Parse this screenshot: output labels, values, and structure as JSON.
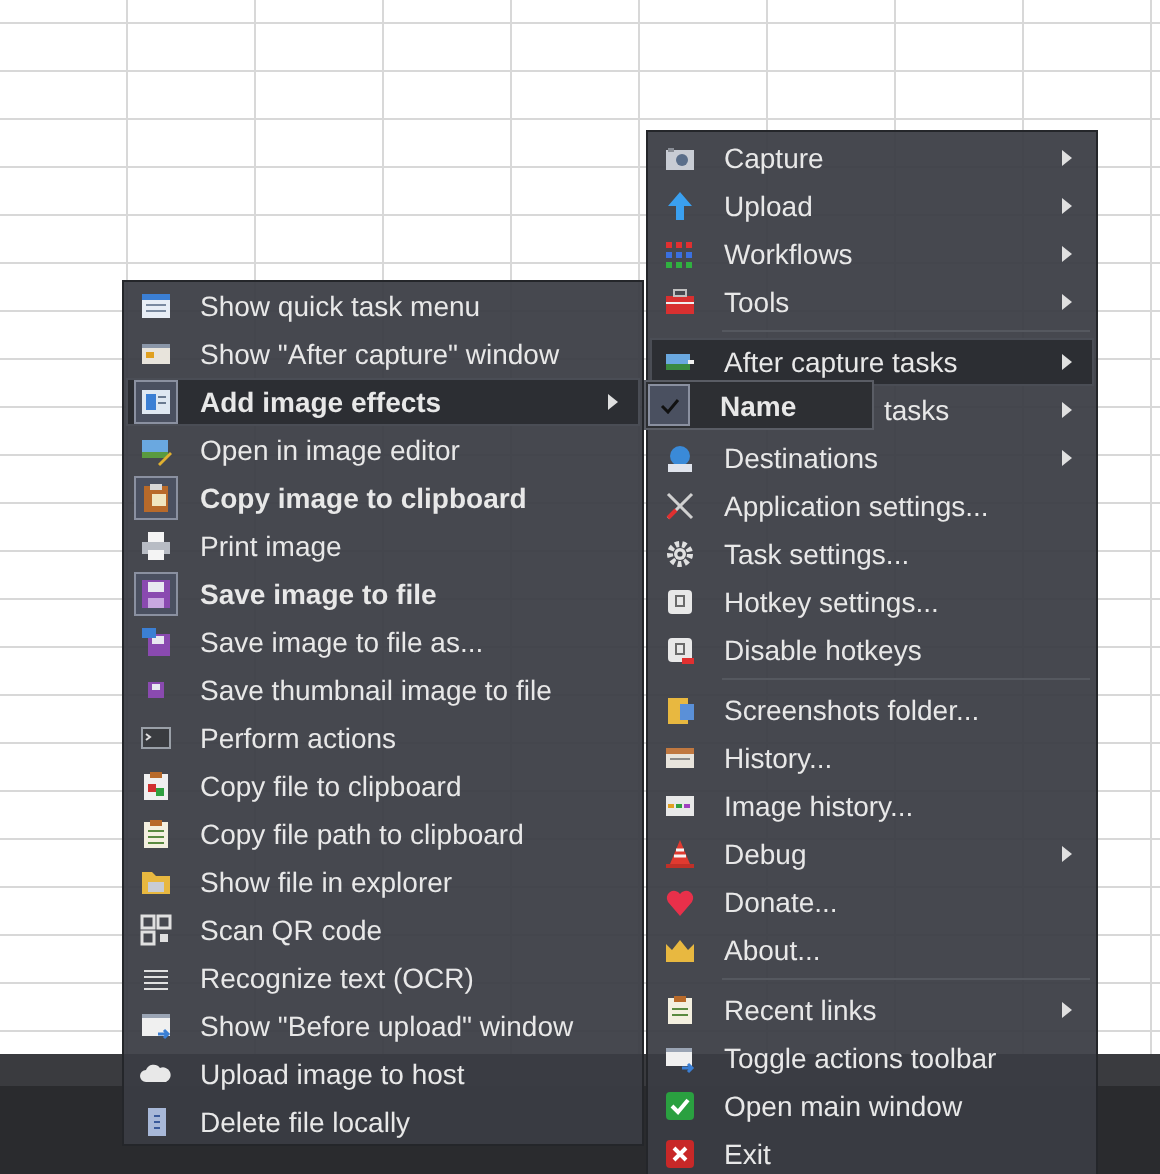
{
  "left_menu": {
    "items": [
      {
        "label": "Show quick task menu",
        "checked": false,
        "selected": false,
        "submenu": false
      },
      {
        "label": "Show \"After capture\" window",
        "checked": false,
        "selected": false,
        "submenu": false
      },
      {
        "label": "Add image effects",
        "checked": true,
        "selected": true,
        "submenu": true
      },
      {
        "label": "Open in image editor",
        "checked": false,
        "selected": false,
        "submenu": false
      },
      {
        "label": "Copy image to clipboard",
        "checked": true,
        "selected": false,
        "submenu": false
      },
      {
        "label": "Print image",
        "checked": false,
        "selected": false,
        "submenu": false
      },
      {
        "label": "Save image to file",
        "checked": true,
        "selected": false,
        "submenu": false
      },
      {
        "label": "Save image to file as...",
        "checked": false,
        "selected": false,
        "submenu": false
      },
      {
        "label": "Save thumbnail image to file",
        "checked": false,
        "selected": false,
        "submenu": false
      },
      {
        "label": "Perform actions",
        "checked": false,
        "selected": false,
        "submenu": false
      },
      {
        "label": "Copy file to clipboard",
        "checked": false,
        "selected": false,
        "submenu": false
      },
      {
        "label": "Copy file path to clipboard",
        "checked": false,
        "selected": false,
        "submenu": false
      },
      {
        "label": "Show file in explorer",
        "checked": false,
        "selected": false,
        "submenu": false
      },
      {
        "label": "Scan QR code",
        "checked": false,
        "selected": false,
        "submenu": false
      },
      {
        "label": "Recognize text (OCR)",
        "checked": false,
        "selected": false,
        "submenu": false
      },
      {
        "label": "Show \"Before upload\" window",
        "checked": false,
        "selected": false,
        "submenu": false
      },
      {
        "label": "Upload image to host",
        "checked": false,
        "selected": false,
        "submenu": false
      },
      {
        "label": "Delete file locally",
        "checked": false,
        "selected": false,
        "submenu": false
      }
    ]
  },
  "right_menu": {
    "items": [
      {
        "kind": "item",
        "label": "Capture",
        "selected": false,
        "submenu": true
      },
      {
        "kind": "item",
        "label": "Upload",
        "selected": false,
        "submenu": true
      },
      {
        "kind": "item",
        "label": "Workflows",
        "selected": false,
        "submenu": true
      },
      {
        "kind": "item",
        "label": "Tools",
        "selected": false,
        "submenu": true
      },
      {
        "kind": "separator"
      },
      {
        "kind": "item",
        "label": "After capture tasks",
        "selected": true,
        "submenu": true
      },
      {
        "kind": "covered",
        "label": "tasks",
        "selected": false,
        "submenu": true
      },
      {
        "kind": "item",
        "label": "Destinations",
        "selected": false,
        "submenu": true
      },
      {
        "kind": "item",
        "label": "Application settings...",
        "selected": false,
        "submenu": false
      },
      {
        "kind": "item",
        "label": "Task settings...",
        "selected": false,
        "submenu": false
      },
      {
        "kind": "item",
        "label": "Hotkey settings...",
        "selected": false,
        "submenu": false
      },
      {
        "kind": "item",
        "label": "Disable hotkeys",
        "selected": false,
        "submenu": false
      },
      {
        "kind": "separator"
      },
      {
        "kind": "item",
        "label": "Screenshots folder...",
        "selected": false,
        "submenu": false
      },
      {
        "kind": "item",
        "label": "History...",
        "selected": false,
        "submenu": false
      },
      {
        "kind": "item",
        "label": "Image history...",
        "selected": false,
        "submenu": false
      },
      {
        "kind": "item",
        "label": "Debug",
        "selected": false,
        "submenu": true
      },
      {
        "kind": "item",
        "label": "Donate...",
        "selected": false,
        "submenu": false
      },
      {
        "kind": "item",
        "label": "About...",
        "selected": false,
        "submenu": false
      },
      {
        "kind": "separator"
      },
      {
        "kind": "item",
        "label": "Recent links",
        "selected": false,
        "submenu": true
      },
      {
        "kind": "item",
        "label": "Toggle actions toolbar",
        "selected": false,
        "submenu": false
      },
      {
        "kind": "item",
        "label": "Open main window",
        "selected": false,
        "submenu": false
      },
      {
        "kind": "item",
        "label": "Exit",
        "selected": false,
        "submenu": false
      }
    ]
  },
  "drag_chip": {
    "label": "Name",
    "checked": true
  }
}
